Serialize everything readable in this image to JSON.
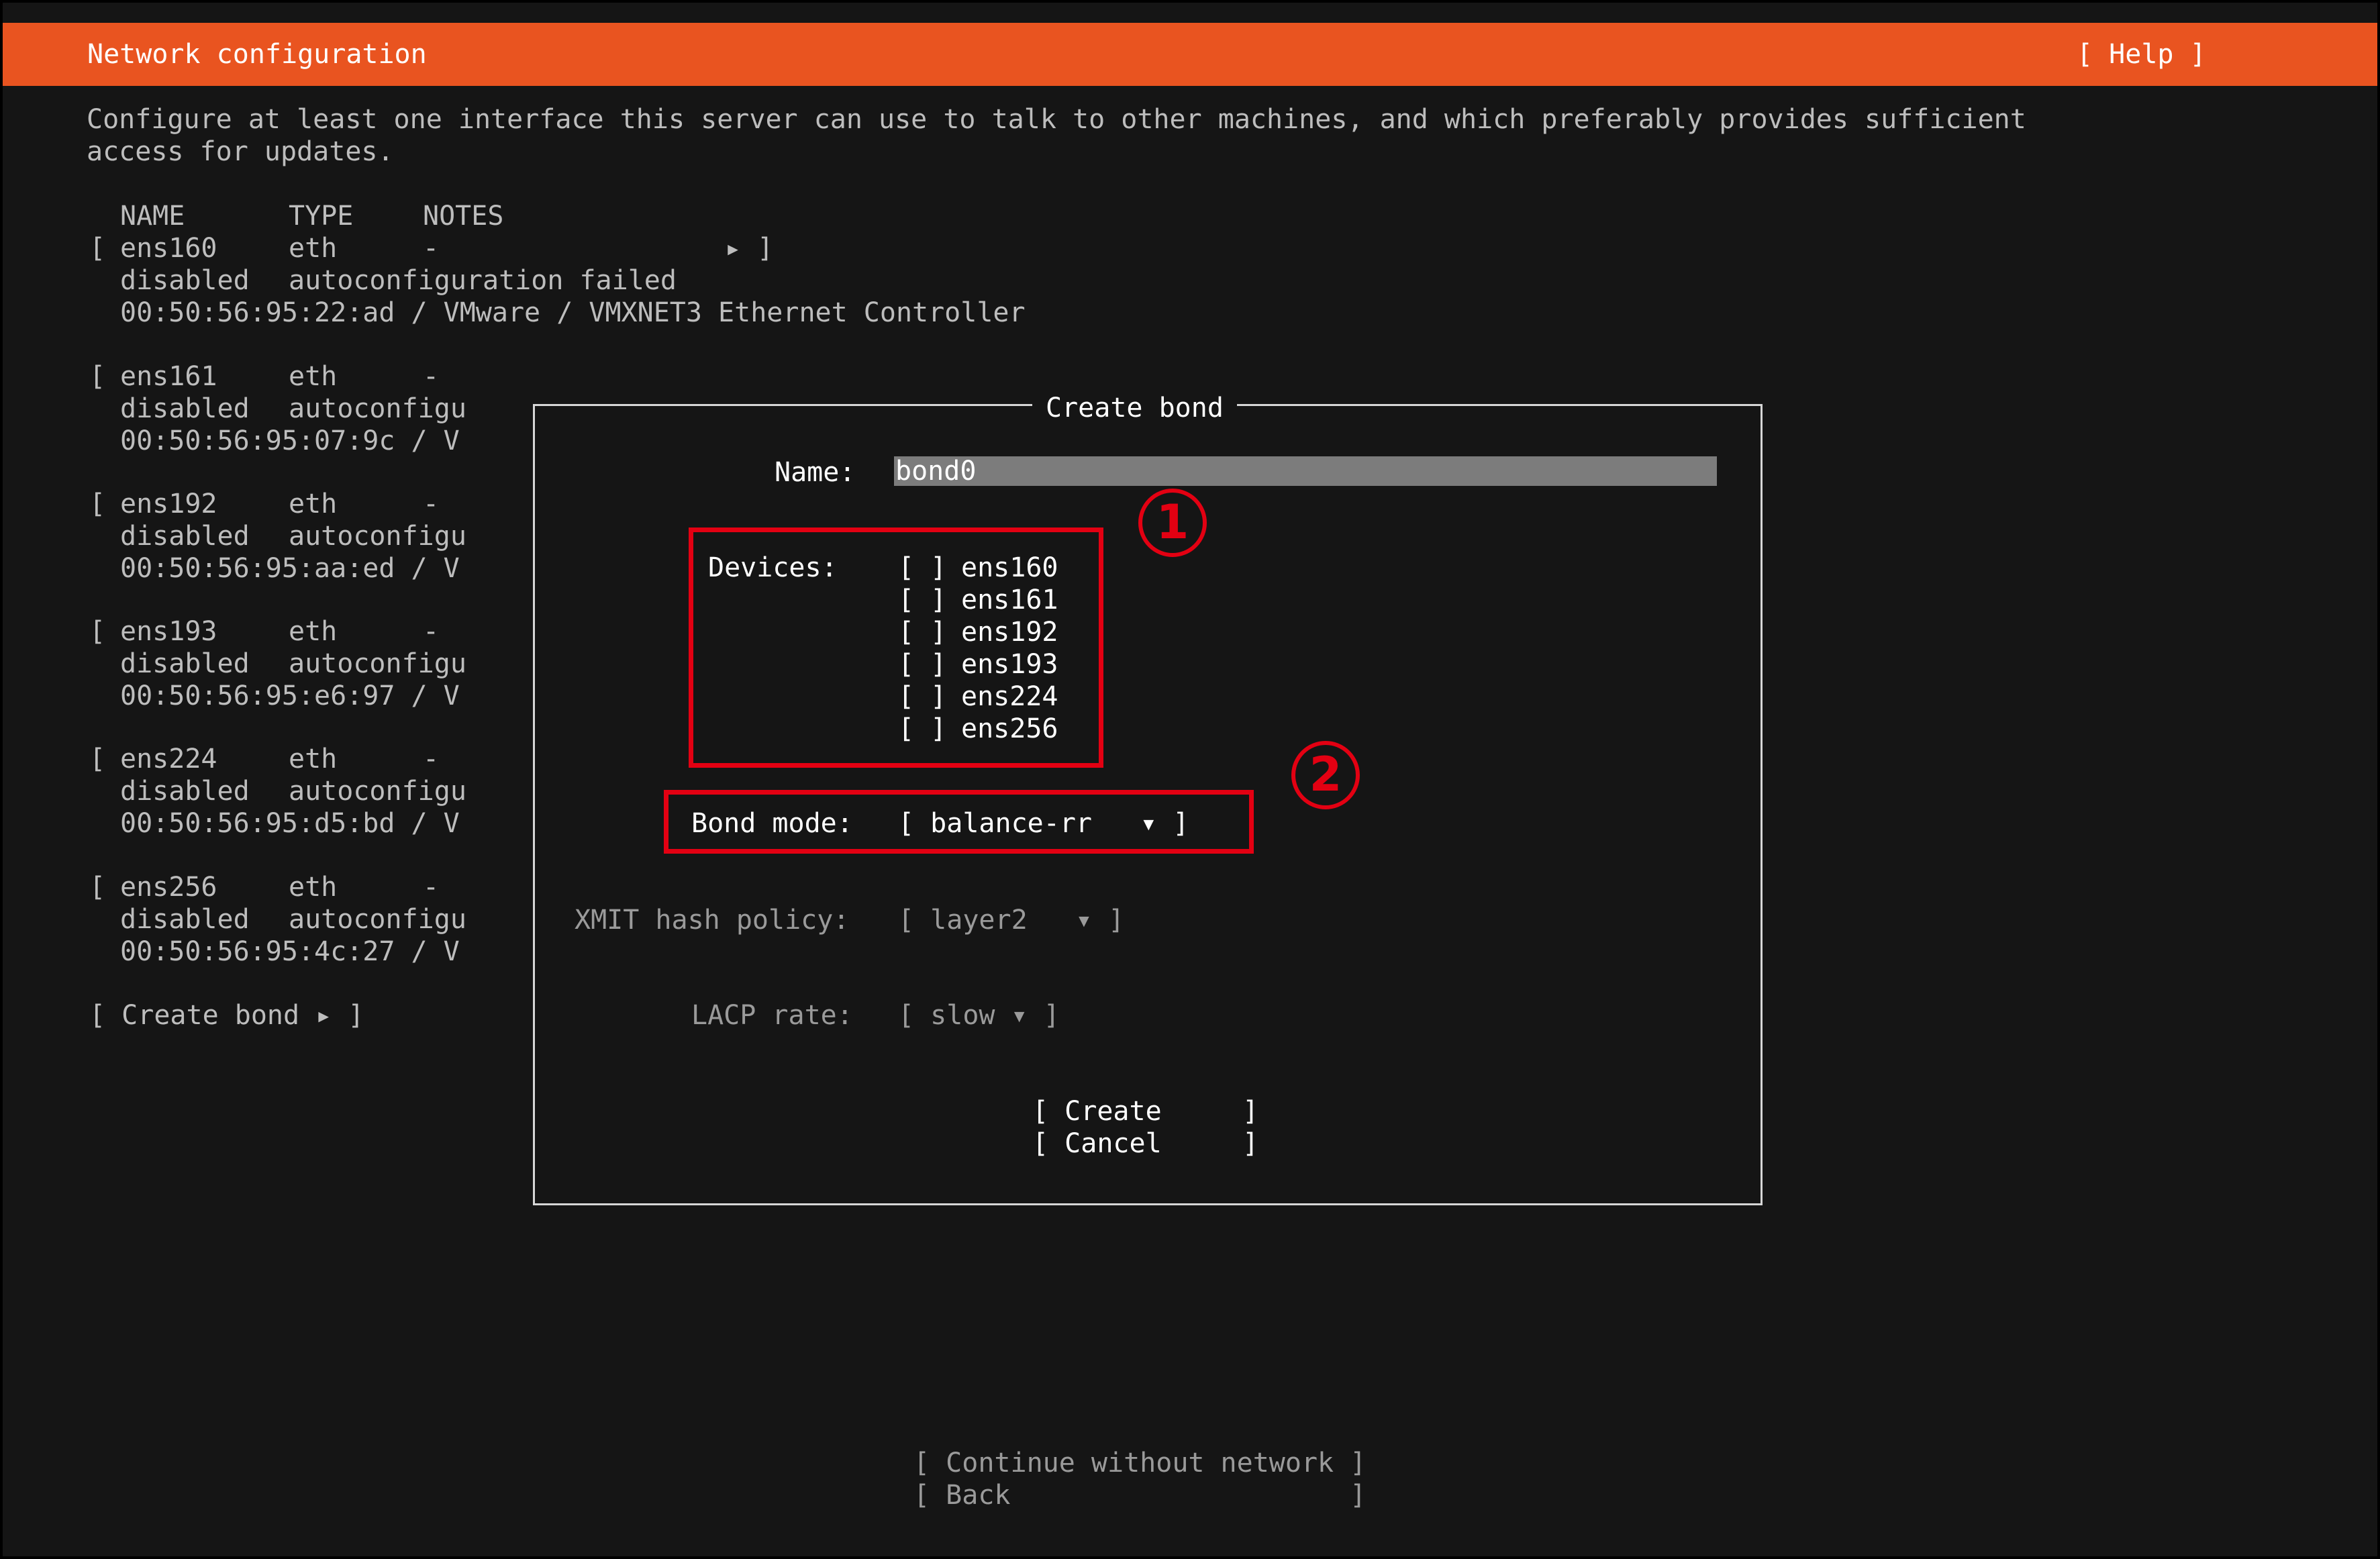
{
  "header": {
    "title": "Network configuration",
    "help_label": "[ Help ]",
    "accent_color": "#e95420"
  },
  "intro": {
    "line1": "Configure at least one interface this server can use to talk to other machines, and which preferably provides sufficient",
    "line2": "access for updates."
  },
  "table": {
    "headers": {
      "name": "NAME",
      "type": "TYPE",
      "notes": "NOTES"
    },
    "interfaces": [
      {
        "bracket": "[",
        "name": "ens160",
        "type": "eth",
        "notes": "-",
        "arrow": "▸ ]",
        "status": "disabled",
        "detail": "autoconfiguration failed",
        "hw": "00:50:56:95:22:ad / VMware / VMXNET3 Ethernet Controller"
      },
      {
        "bracket": "[",
        "name": "ens161",
        "type": "eth",
        "notes": "-",
        "status": "disabled",
        "detail": "autoconfigu",
        "hw": "00:50:56:95:07:9c / V"
      },
      {
        "bracket": "[",
        "name": "ens192",
        "type": "eth",
        "notes": "-",
        "status": "disabled",
        "detail": "autoconfigu",
        "hw": "00:50:56:95:aa:ed / V"
      },
      {
        "bracket": "[",
        "name": "ens193",
        "type": "eth",
        "notes": "-",
        "status": "disabled",
        "detail": "autoconfigu",
        "hw": "00:50:56:95:e6:97 / V"
      },
      {
        "bracket": "[",
        "name": "ens224",
        "type": "eth",
        "notes": "-",
        "status": "disabled",
        "detail": "autoconfigu",
        "hw": "00:50:56:95:d5:bd / V"
      },
      {
        "bracket": "[",
        "name": "ens256",
        "type": "eth",
        "notes": "-",
        "status": "disabled",
        "detail": "autoconfigu",
        "hw": "00:50:56:95:4c:27 / V"
      }
    ],
    "create_bond": "[ Create bond ▸ ]"
  },
  "dialog": {
    "title": "Create bond",
    "name_label": "Name:",
    "name_value": "bond0",
    "devices_label": "Devices:",
    "devices": [
      {
        "checkbox": "[ ]",
        "name": "ens160"
      },
      {
        "checkbox": "[ ]",
        "name": "ens161"
      },
      {
        "checkbox": "[ ]",
        "name": "ens192"
      },
      {
        "checkbox": "[ ]",
        "name": "ens193"
      },
      {
        "checkbox": "[ ]",
        "name": "ens224"
      },
      {
        "checkbox": "[ ]",
        "name": "ens256"
      }
    ],
    "bond_mode_label": "Bond mode:",
    "bond_mode_value": "[ balance-rr   ▾ ]",
    "xmit_label": "XMIT hash policy:",
    "xmit_value": "[ layer2   ▾ ]",
    "lacp_label": "LACP rate:",
    "lacp_value": "[ slow ▾ ]",
    "create_button": "[ Create     ]",
    "cancel_button": "[ Cancel     ]"
  },
  "annotations": {
    "marker1": "1",
    "marker2": "2",
    "color": "#e30012"
  },
  "footer": {
    "continue_button": "[ Continue without network ]",
    "back_button": "[ Back                     ]"
  }
}
